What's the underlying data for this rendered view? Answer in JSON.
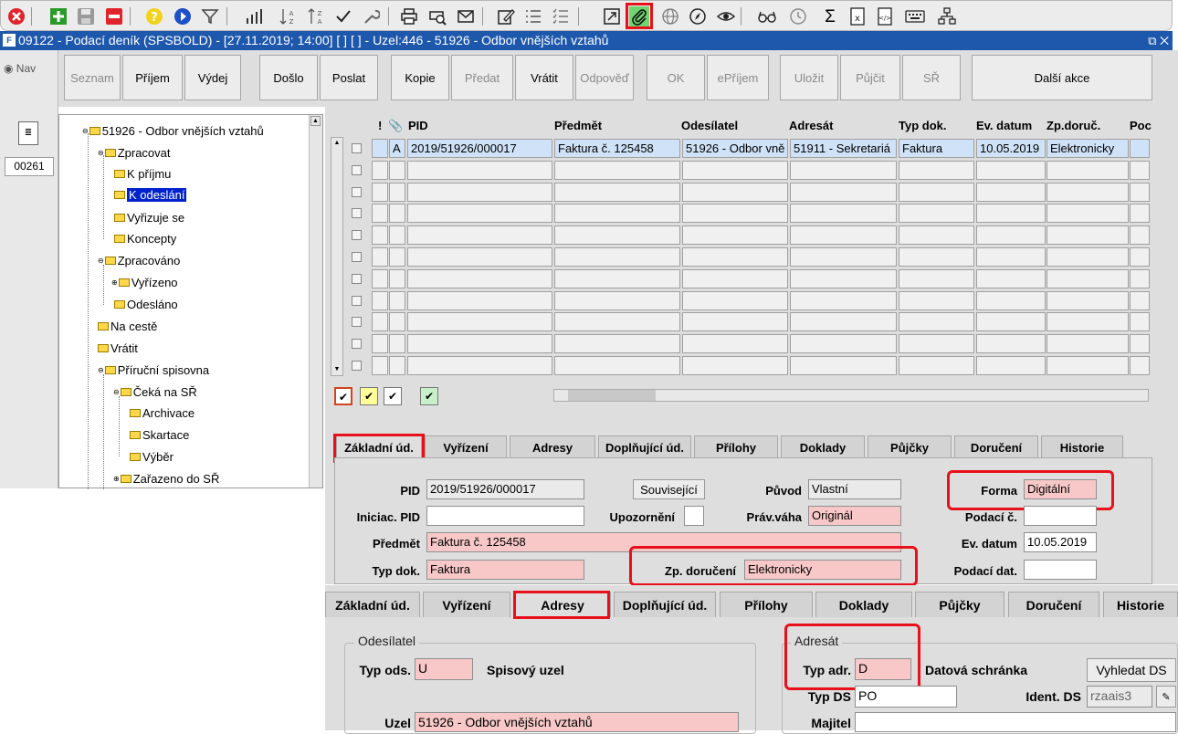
{
  "toolbar": {
    "icons": [
      "close-icon",
      "add-icon",
      "save-icon",
      "delete-icon",
      "help-icon",
      "forward-icon",
      "filter-icon",
      "chart-icon",
      "sort-asc-icon",
      "sort-desc-icon",
      "check-icon",
      "wrench-icon",
      "print-icon",
      "print-preview-icon",
      "mail-icon",
      "edit-icon",
      "list-icon",
      "checklist-icon",
      "export-icon",
      "attachment-icon",
      "globe-icon",
      "compass-icon",
      "eye-icon",
      "glasses-icon",
      "clock-icon",
      "sum-icon",
      "excel-icon",
      "html-icon",
      "keyboard-icon",
      "hierarchy-icon"
    ]
  },
  "window": {
    "logo": "F",
    "title": "09122 - Podací deník (SPSBOLD) - [27.11.2019; 14:00]  [ ]  [ ] - Uzel:446 - 51926 - Odbor vnějších vztahů",
    "controls": "⧉ ✕"
  },
  "nav": {
    "radio_label": "◉ Nav",
    "number": "00261"
  },
  "actions": {
    "seznam": "Seznam",
    "prijem": "Příjem",
    "vydej": "Výdej",
    "doslo": "Došlo",
    "poslat": "Poslat",
    "kopie": "Kopie",
    "predat": "Předat",
    "vratit": "Vrátit",
    "odpoved": "Odpověď",
    "ok": "OK",
    "eprijem": "ePříjem",
    "ulozit": "Uložit",
    "pujcit": "Půjčit",
    "sr": "SŘ",
    "dalsi": "Další akce"
  },
  "tree": {
    "root": "51926 - Odbor vnějších vztahů",
    "zpracovat": "Zpracovat",
    "k_prijmu": "K příjmu",
    "k_odeslani": "K odeslání",
    "vyrizuje_se": "Vyřizuje se",
    "koncepty": "Koncepty",
    "zpracovano": "Zpracováno",
    "vyrizeno": "Vyřízeno",
    "odeslano": "Odesláno",
    "na_ceste": "Na cestě",
    "vratit": "Vrátit",
    "prirucni": "Příruční spisovna",
    "ceka_na_sr": "Čeká na SŘ",
    "archivace": "Archivace",
    "skartace": "Skartace",
    "vyber": "Výběr",
    "zarazeno": "Zařazeno do SŘ"
  },
  "grid": {
    "headers": {
      "excl": "!",
      "attach": "📎",
      "pid": "PID",
      "predmet": "Předmět",
      "odesilatel": "Odesílatel",
      "adresat": "Adresát",
      "typ_dok": "Typ dok.",
      "ev_datum": "Ev. datum",
      "zp_doruc": "Zp.doruč.",
      "poc": "Poc"
    },
    "row1": {
      "flag": "A",
      "pid": "2019/51926/000017",
      "predmet": "Faktura č. 125458",
      "odesilatel": "51926 - Odbor vně",
      "adresat": "51911 - Sekretariá",
      "typ_dok": "Faktura",
      "ev_datum": "10.05.2019",
      "zp_doruc": "Elektronicky"
    }
  },
  "tabs1": {
    "zakladni": "Základní úd.",
    "vyrizeni": "Vyřízení",
    "adresy": "Adresy",
    "doplnujici": "Doplňující úd.",
    "prilohy": "Přílohy",
    "doklady": "Doklady",
    "pujcky": "Půjčky",
    "doruceni": "Doručení",
    "historie": "Historie"
  },
  "form1": {
    "pid_label": "PID",
    "pid_value": "2019/51926/000017",
    "souvisejici": "Související",
    "puvod_label": "Původ",
    "puvod_value": "Vlastní",
    "forma_label": "Forma",
    "forma_value": "Digitální",
    "iniciac_label": "Iniciac. PID",
    "iniciac_value": "",
    "upozorneni_label": "Upozornění",
    "pravvaha_label": "Práv.váha",
    "pravvaha_value": "Originál",
    "podaci_c_label": "Podací č.",
    "podaci_c_value": "",
    "predmet_label": "Předmět",
    "predmet_value": "Faktura č. 125458",
    "evdatum_label": "Ev. datum",
    "evdatum_value": "10.05.2019",
    "typdok_label": "Typ dok.",
    "typdok_value": "Faktura",
    "zpdoruceni_label": "Zp. doručení",
    "zpdoruceni_value": "Elektronicky",
    "podacidat_label": "Podací dat.",
    "podacidat_value": ""
  },
  "tabs2": {
    "zakladni": "Základní úd.",
    "vyrizeni": "Vyřízení",
    "adresy": "Adresy",
    "doplnujici": "Doplňující úd.",
    "prilohy": "Přílohy",
    "doklady": "Doklady",
    "pujcky": "Půjčky",
    "doruceni": "Doručení",
    "historie": "Historie"
  },
  "form2": {
    "odesilatel_group": "Odesílatel",
    "typods_label": "Typ ods.",
    "typods_value": "U",
    "typods_text": "Spisový uzel",
    "uzel_label": "Uzel",
    "uzel_value": "51926 - Odbor vnějších vztahů",
    "adresat_group": "Adresát",
    "typadr_label": "Typ adr.",
    "typadr_value": "D",
    "typadr_text": "Datová schránka",
    "vyhledat": "Vyhledat DS",
    "typds_label": "Typ DS",
    "typds_value": "PO",
    "identds_label": "Ident. DS",
    "identds_value": "rzaais3",
    "majitel_label": "Majitel",
    "majitel_value": ""
  },
  "colors": {
    "highlight": "#e8101a",
    "required_field": "#f8c8c8",
    "selection": "#0022cc",
    "title_bar": "#1e58ad"
  }
}
